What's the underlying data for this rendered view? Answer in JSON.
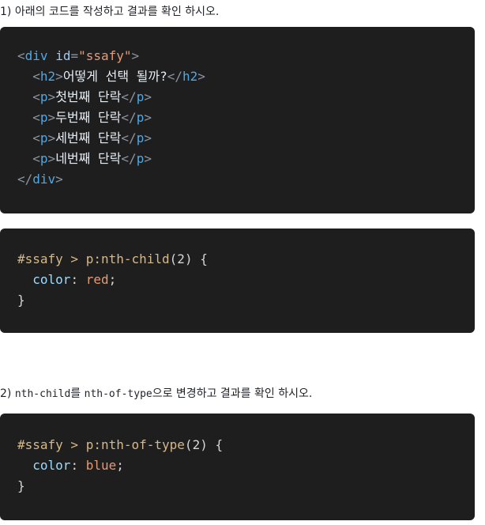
{
  "q1": {
    "text": "1)  아래의 코드를 작성하고 결과를 확인 하시오."
  },
  "block1": {
    "indent": "  ",
    "div_open": {
      "lt": "<",
      "name": "div",
      "attr": "id",
      "eq": "=",
      "value": "\"ssafy\"",
      "gt": ">"
    },
    "h2": {
      "open_lt": "<",
      "open_name": "h2",
      "open_gt": ">",
      "text": "어떻게 선택 될까?",
      "close_lt": "</",
      "close_name": "h2",
      "close_gt": ">"
    },
    "paragraphs": [
      {
        "text": "첫번째 단락"
      },
      {
        "text": "두번째 단락"
      },
      {
        "text": "세번째 단락"
      },
      {
        "text": "네번째 단락"
      }
    ],
    "p_tag": {
      "open_lt": "<",
      "name": "p",
      "open_gt": ">",
      "close_lt": "</",
      "close_gt": ">"
    },
    "div_close": {
      "lt": "</",
      "name": "div",
      "gt": ">"
    }
  },
  "block2": {
    "selector": "#ssafy > p:nth-child",
    "paren_open": "(",
    "arg": "2",
    "paren_close": ")",
    "brace_open": " {",
    "prop": "color",
    "colon": ": ",
    "value": "red",
    "semicolon": ";",
    "brace_close": "}"
  },
  "q2": {
    "prefix": "2) ",
    "code1": "nth-child",
    "mid": "를 ",
    "code2": "nth-of-type",
    "suffix": "으로 변경하고 결과를 확인 하시오."
  },
  "block3": {
    "selector": "#ssafy > p:nth-of-type",
    "paren_open": "(",
    "arg": "2",
    "paren_close": ")",
    "brace_open": " {",
    "prop": "color",
    "colon": ": ",
    "value": "blue",
    "semicolon": ";",
    "brace_close": "}"
  }
}
